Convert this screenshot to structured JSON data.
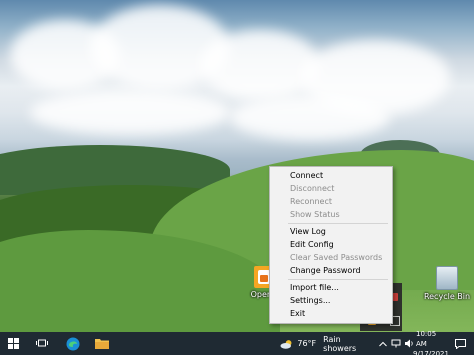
{
  "context_menu": {
    "items": [
      {
        "label": "Connect",
        "enabled": true
      },
      {
        "label": "Disconnect",
        "enabled": false
      },
      {
        "label": "Reconnect",
        "enabled": false
      },
      {
        "label": "Show Status",
        "enabled": false
      },
      {
        "label": "View Log",
        "enabled": true
      },
      {
        "label": "Edit Config",
        "enabled": true
      },
      {
        "label": "Clear Saved Passwords",
        "enabled": false
      },
      {
        "label": "Change Password",
        "enabled": true
      },
      {
        "label": "Import file...",
        "enabled": true
      },
      {
        "label": "Settings...",
        "enabled": true
      },
      {
        "label": "Exit",
        "enabled": true
      }
    ]
  },
  "desktop_icons": {
    "openvpn": {
      "label": "OpenV",
      "icon": "openvpn-icon"
    },
    "recycle_bin": {
      "label": "Recycle Bin",
      "icon": "recycle-bin-icon"
    }
  },
  "taskbar": {
    "weather": {
      "temp": "76°F",
      "condition": "Rain showers",
      "icon": "cloud-sun-icon"
    },
    "time": "10:05 AM",
    "date": "9/17/2021"
  },
  "colors": {
    "taskbar_bg": "#1f2a33",
    "menu_bg": "#f2f2f2",
    "disabled_text": "#8c8c8c"
  }
}
